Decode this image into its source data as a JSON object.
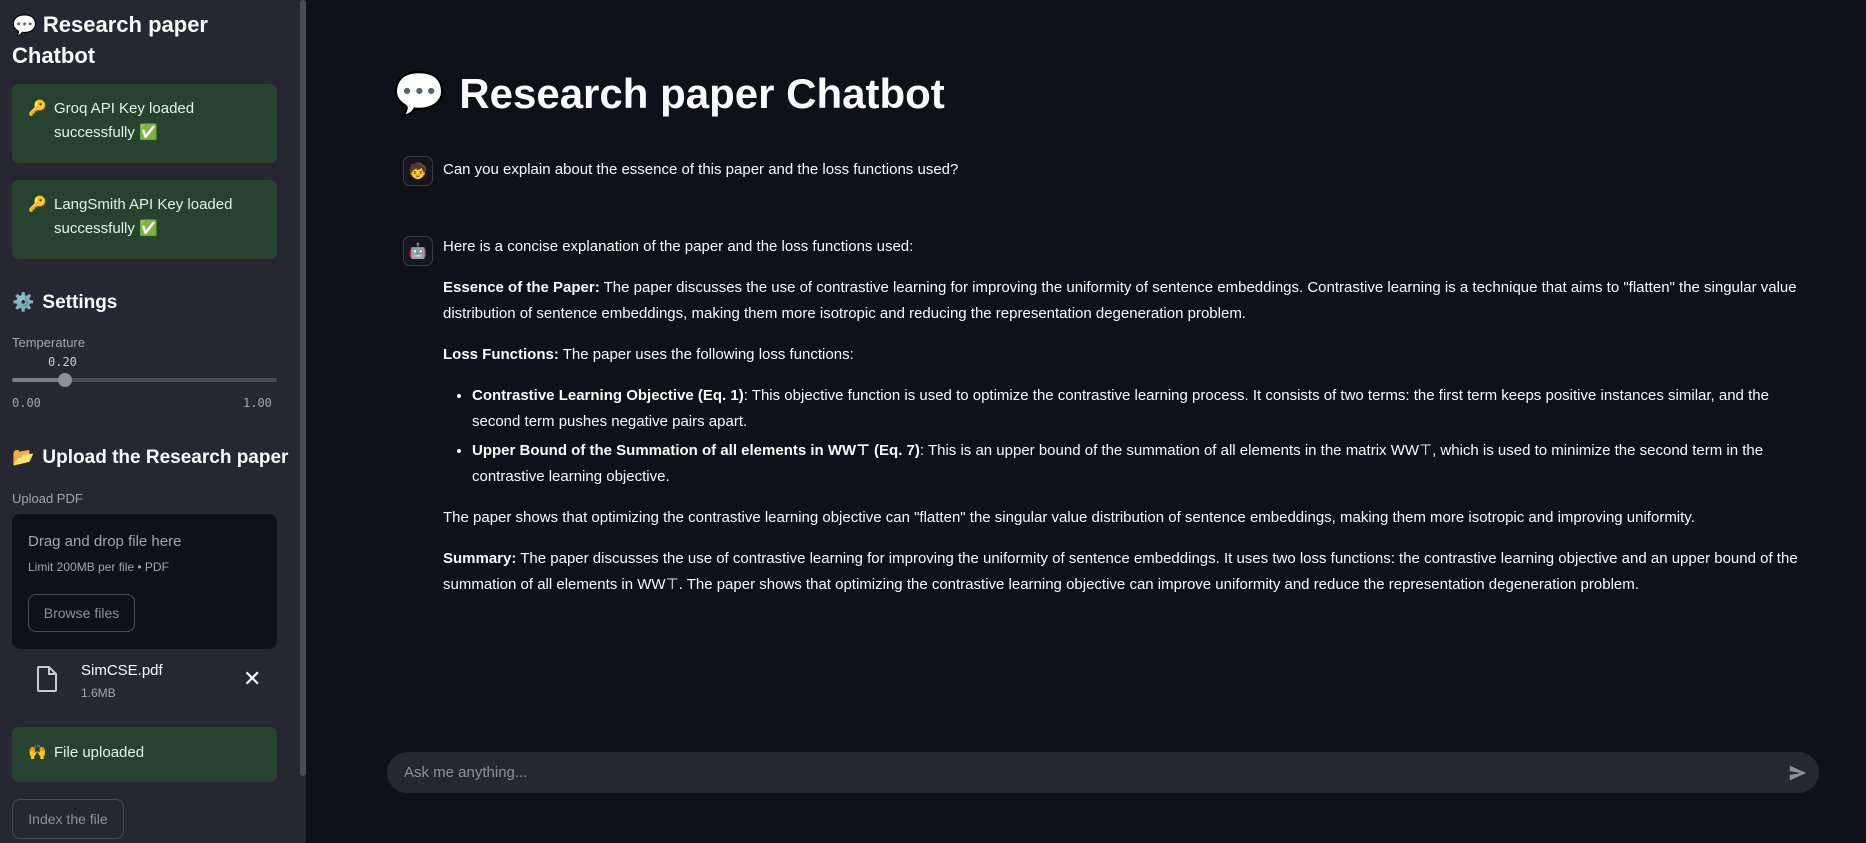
{
  "sidebar": {
    "title_icon": "💬",
    "title": "Research paper Chatbot",
    "alerts": [
      {
        "emoji": "🔑",
        "line1": "Groq API Key loaded",
        "line2": "successfully ✅"
      },
      {
        "emoji": "🔑",
        "line1": "LangSmith API Key loaded",
        "line2": "successfully ✅"
      }
    ],
    "settings": {
      "icon": "⚙️",
      "title": "Settings"
    },
    "temperature": {
      "label": "Temperature",
      "value": "0.20",
      "min": "0.00",
      "max": "1.00",
      "fraction": 0.2
    },
    "upload": {
      "icon": "📂",
      "title": "Upload the Research paper",
      "label": "Upload PDF"
    },
    "dropzone": {
      "title": "Drag and drop file here",
      "subtitle": "Limit 200MB per file • PDF",
      "browse": "Browse files"
    },
    "file": {
      "name": "SimCSE.pdf",
      "size": "1.6MB",
      "remove": "✕"
    },
    "uploaded_alert": {
      "emoji": "🙌",
      "text": "File uploaded"
    },
    "index_button": "Index the file"
  },
  "main": {
    "title_icon": "💬",
    "title": "Research paper Chatbot",
    "user_message": "Can you explain about the essence of this paper and the loss functions used?",
    "assistant": {
      "intro": "Here is a concise explanation of the paper and the loss functions used:",
      "essence_label": "Essence of the Paper:",
      "essence_text": " The paper discusses the use of contrastive learning for improving the uniformity of sentence embeddings. Contrastive learning is a technique that aims to \"flatten\" the singular value distribution of sentence embeddings, making them more isotropic and reducing the representation degeneration problem.",
      "loss_label": "Loss Functions:",
      "loss_text": " The paper uses the following loss functions:",
      "bullets": [
        {
          "label": "Contrastive Learning Objective (Eq. 1)",
          "text": ": This objective function is used to optimize the contrastive learning process. It consists of two terms: the first term keeps positive instances similar, and the second term pushes negative pairs apart."
        },
        {
          "label": "Upper Bound of the Summation of all elements in WW⊤ (Eq. 7)",
          "text": ": This is an upper bound of the summation of all elements in the matrix WW⊤, which is used to minimize the second term in the contrastive learning objective."
        }
      ],
      "conclusion": "The paper shows that optimizing the contrastive learning objective can \"flatten\" the singular value distribution of sentence embeddings, making them more isotropic and improving uniformity.",
      "summary_label": "Summary:",
      "summary_text": " The paper discusses the use of contrastive learning for improving the uniformity of sentence embeddings. It uses two loss functions: the contrastive learning objective and an upper bound of the summation of all elements in WW⊤. The paper shows that optimizing the contrastive learning objective can improve uniformity and reduce the representation degeneration problem."
    },
    "chat_input_placeholder": "Ask me anything..."
  },
  "icons": {
    "user_avatar": "🧒",
    "assistant_avatar": "🤖",
    "send": "send-icon",
    "file": "file-icon"
  }
}
